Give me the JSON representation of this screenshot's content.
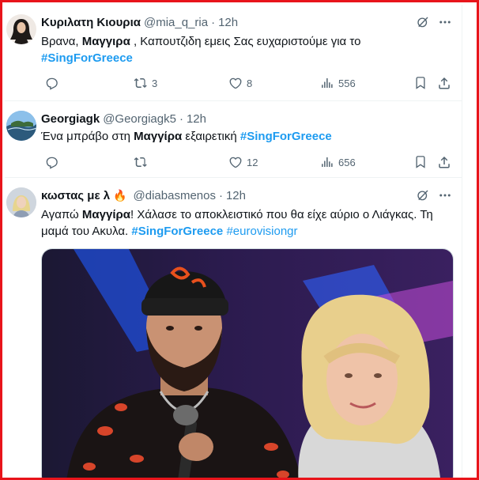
{
  "tweets": [
    {
      "name": "Κυριλατη Κιουρια",
      "handle": "@mia_q_ria",
      "time": "12h",
      "text": {
        "p1": "Βρανα, ",
        "b1": "Μαγγιρα",
        "p2": " , Καπουτζιδη εμεις Σας ευχαριστούμε για το",
        "tag1": "#SingForGreece"
      },
      "stats": {
        "replies": "",
        "retweets": "3",
        "likes": "8",
        "views": "556"
      }
    },
    {
      "name": "Georgiagk",
      "handle": "@Georgiagk5",
      "time": "12h",
      "text": {
        "p1": "Ένα μπράβο στη ",
        "b1": "Μαγγίρα",
        "p2": " εξαιρετική  ",
        "tag1": "#SingForGreece"
      },
      "stats": {
        "replies": "",
        "retweets": "",
        "likes": "12",
        "views": "656"
      }
    },
    {
      "name": "κωστας με λ",
      "emoji": "🔥",
      "handle": "@diabasmenos",
      "time": "12h",
      "text": {
        "p1": "Αγαπώ ",
        "b1": "Μαγγίρα",
        "p2": "! Χάλασε το αποκλειστικό που θα είχε αύριο ο Λιάγκας. Τη μαμά του Ακυλα. ",
        "tag1": "#SingForGreece",
        "tag2": "#eurovisiongr"
      },
      "stats": {
        "replies": "",
        "retweets": "",
        "likes": "",
        "views": ""
      }
    }
  ],
  "colors": {
    "border": "#e8141b",
    "accent": "#1d9bf0",
    "muted": "#536471"
  },
  "icons": [
    "reply-icon",
    "retweet-icon",
    "like-icon",
    "views-icon",
    "bookmark-icon",
    "share-icon",
    "grok-icon",
    "more-icon"
  ]
}
